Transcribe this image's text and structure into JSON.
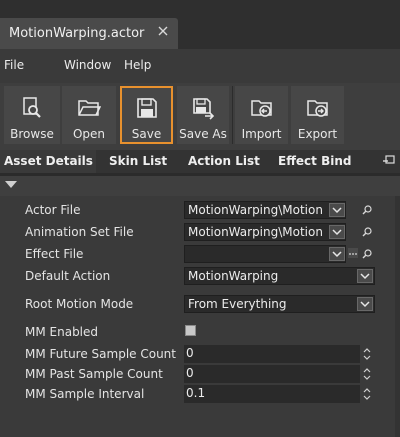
{
  "tab": {
    "title": "MotionWarping.actor"
  },
  "menu": {
    "file": "File",
    "window": "Window",
    "help": "Help"
  },
  "toolbar": {
    "browse": "Browse",
    "open": "Open",
    "save": "Save",
    "save_as": "Save As",
    "import": "Import",
    "export": "Export"
  },
  "subtabs": {
    "asset_details": "Asset Details",
    "skin_list": "Skin List",
    "action_list": "Action List",
    "effect_bind": "Effect Bind"
  },
  "properties": {
    "actor_file": {
      "label": "Actor File",
      "value": "MotionWarping\\Motion"
    },
    "animation_set_file": {
      "label": "Animation Set File",
      "value": "MotionWarping\\Motion"
    },
    "effect_file": {
      "label": "Effect File",
      "value": ""
    },
    "default_action": {
      "label": "Default Action",
      "value": "MotionWarping"
    },
    "root_motion_mode": {
      "label": "Root Motion Mode",
      "value": "From Everything"
    },
    "mm_enabled": {
      "label": "MM Enabled",
      "checked": false
    },
    "mm_future_sample_count": {
      "label": "MM Future Sample Count",
      "value": "0"
    },
    "mm_past_sample_count": {
      "label": "MM Past Sample Count",
      "value": "0"
    },
    "mm_sample_interval": {
      "label": "MM Sample Interval",
      "value": "0.1"
    }
  },
  "colors": {
    "highlight": "#e8912e",
    "panel": "#3a3a3a",
    "input": "#2a2a2a"
  }
}
